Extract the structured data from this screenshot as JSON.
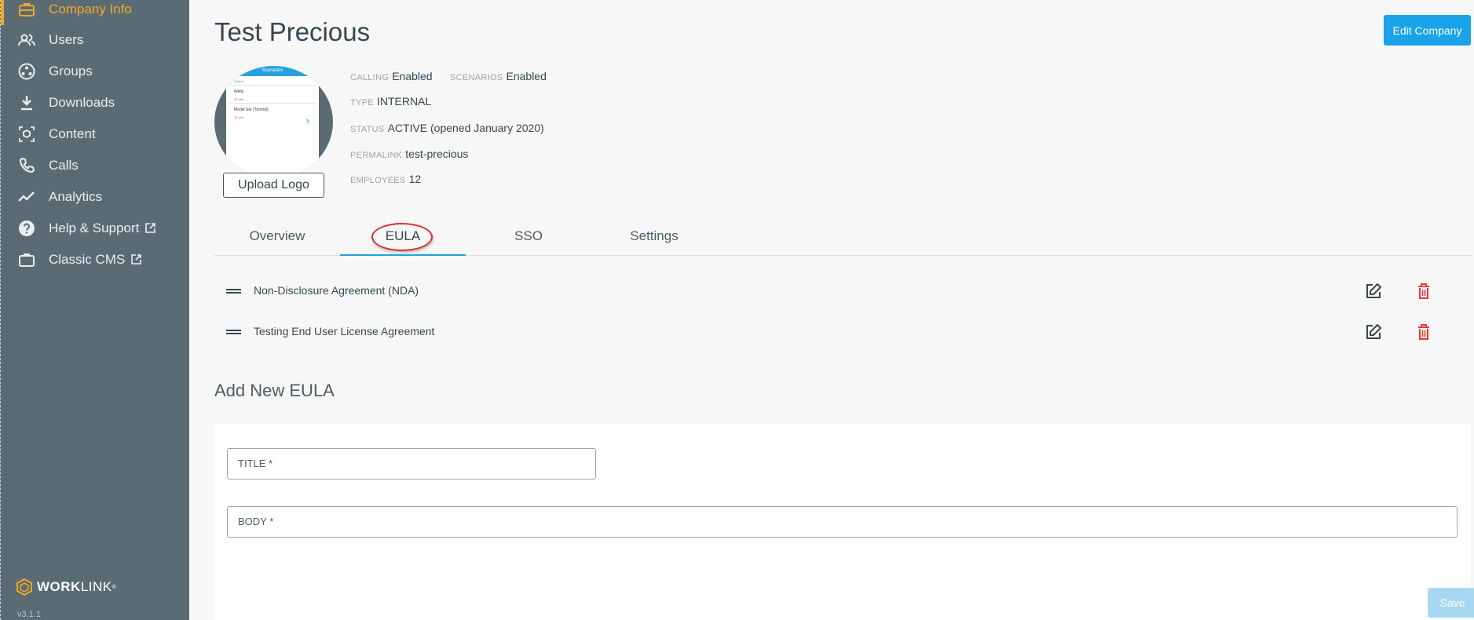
{
  "sidebar": {
    "items": [
      {
        "label": "Company Info",
        "icon": "briefcase-icon",
        "active": true
      },
      {
        "label": "Users",
        "icon": "users-icon"
      },
      {
        "label": "Groups",
        "icon": "groups-icon"
      },
      {
        "label": "Downloads",
        "icon": "download-icon"
      },
      {
        "label": "Content",
        "icon": "content-icon"
      },
      {
        "label": "Calls",
        "icon": "phone-icon"
      },
      {
        "label": "Analytics",
        "icon": "analytics-icon"
      },
      {
        "label": "Help & Support",
        "icon": "help-icon",
        "external": true
      },
      {
        "label": "Classic CMS",
        "icon": "briefcase-icon",
        "external": true
      }
    ],
    "brand": {
      "bold": "WORK",
      "light": "LINK",
      "mark": "®"
    },
    "version": "v3.1.1"
  },
  "company": {
    "name": "Test Precious",
    "edit_label": "Edit Company",
    "upload_logo_label": "Upload Logo",
    "logo_preview": {
      "header": "Scenarios",
      "search": "Search",
      "item1": "Welly",
      "item1_meta": "12 min",
      "item2": "Model Set (Tutorial)",
      "item2_meta": "12 min"
    },
    "meta": {
      "calling_key": "CALLING",
      "calling_val": "Enabled",
      "scenarios_key": "SCENARIOS",
      "scenarios_val": "Enabled",
      "type_key": "TYPE",
      "type_val": "INTERNAL",
      "status_key": "STATUS",
      "status_val": "ACTIVE (opened January 2020)",
      "permalink_key": "PERMALINK",
      "permalink_val": "test-precious",
      "employees_key": "EMPLOYEES",
      "employees_val": "12"
    }
  },
  "tabs": [
    {
      "label": "Overview"
    },
    {
      "label": "EULA",
      "active": true
    },
    {
      "label": "SSO"
    },
    {
      "label": "Settings"
    }
  ],
  "eulas": [
    {
      "title": "Non-Disclosure Agreement (NDA)"
    },
    {
      "title": "Testing End User License Agreement"
    }
  ],
  "add_form": {
    "heading": "Add New EULA",
    "title_label": "TITLE *",
    "body_label": "BODY *",
    "save_label": "Save"
  },
  "colors": {
    "sidebar_bg": "#5a6b73",
    "accent": "#f5a623",
    "primary": "#1aa3e8",
    "delete": "#e53935",
    "annotation": "#d9302e"
  }
}
